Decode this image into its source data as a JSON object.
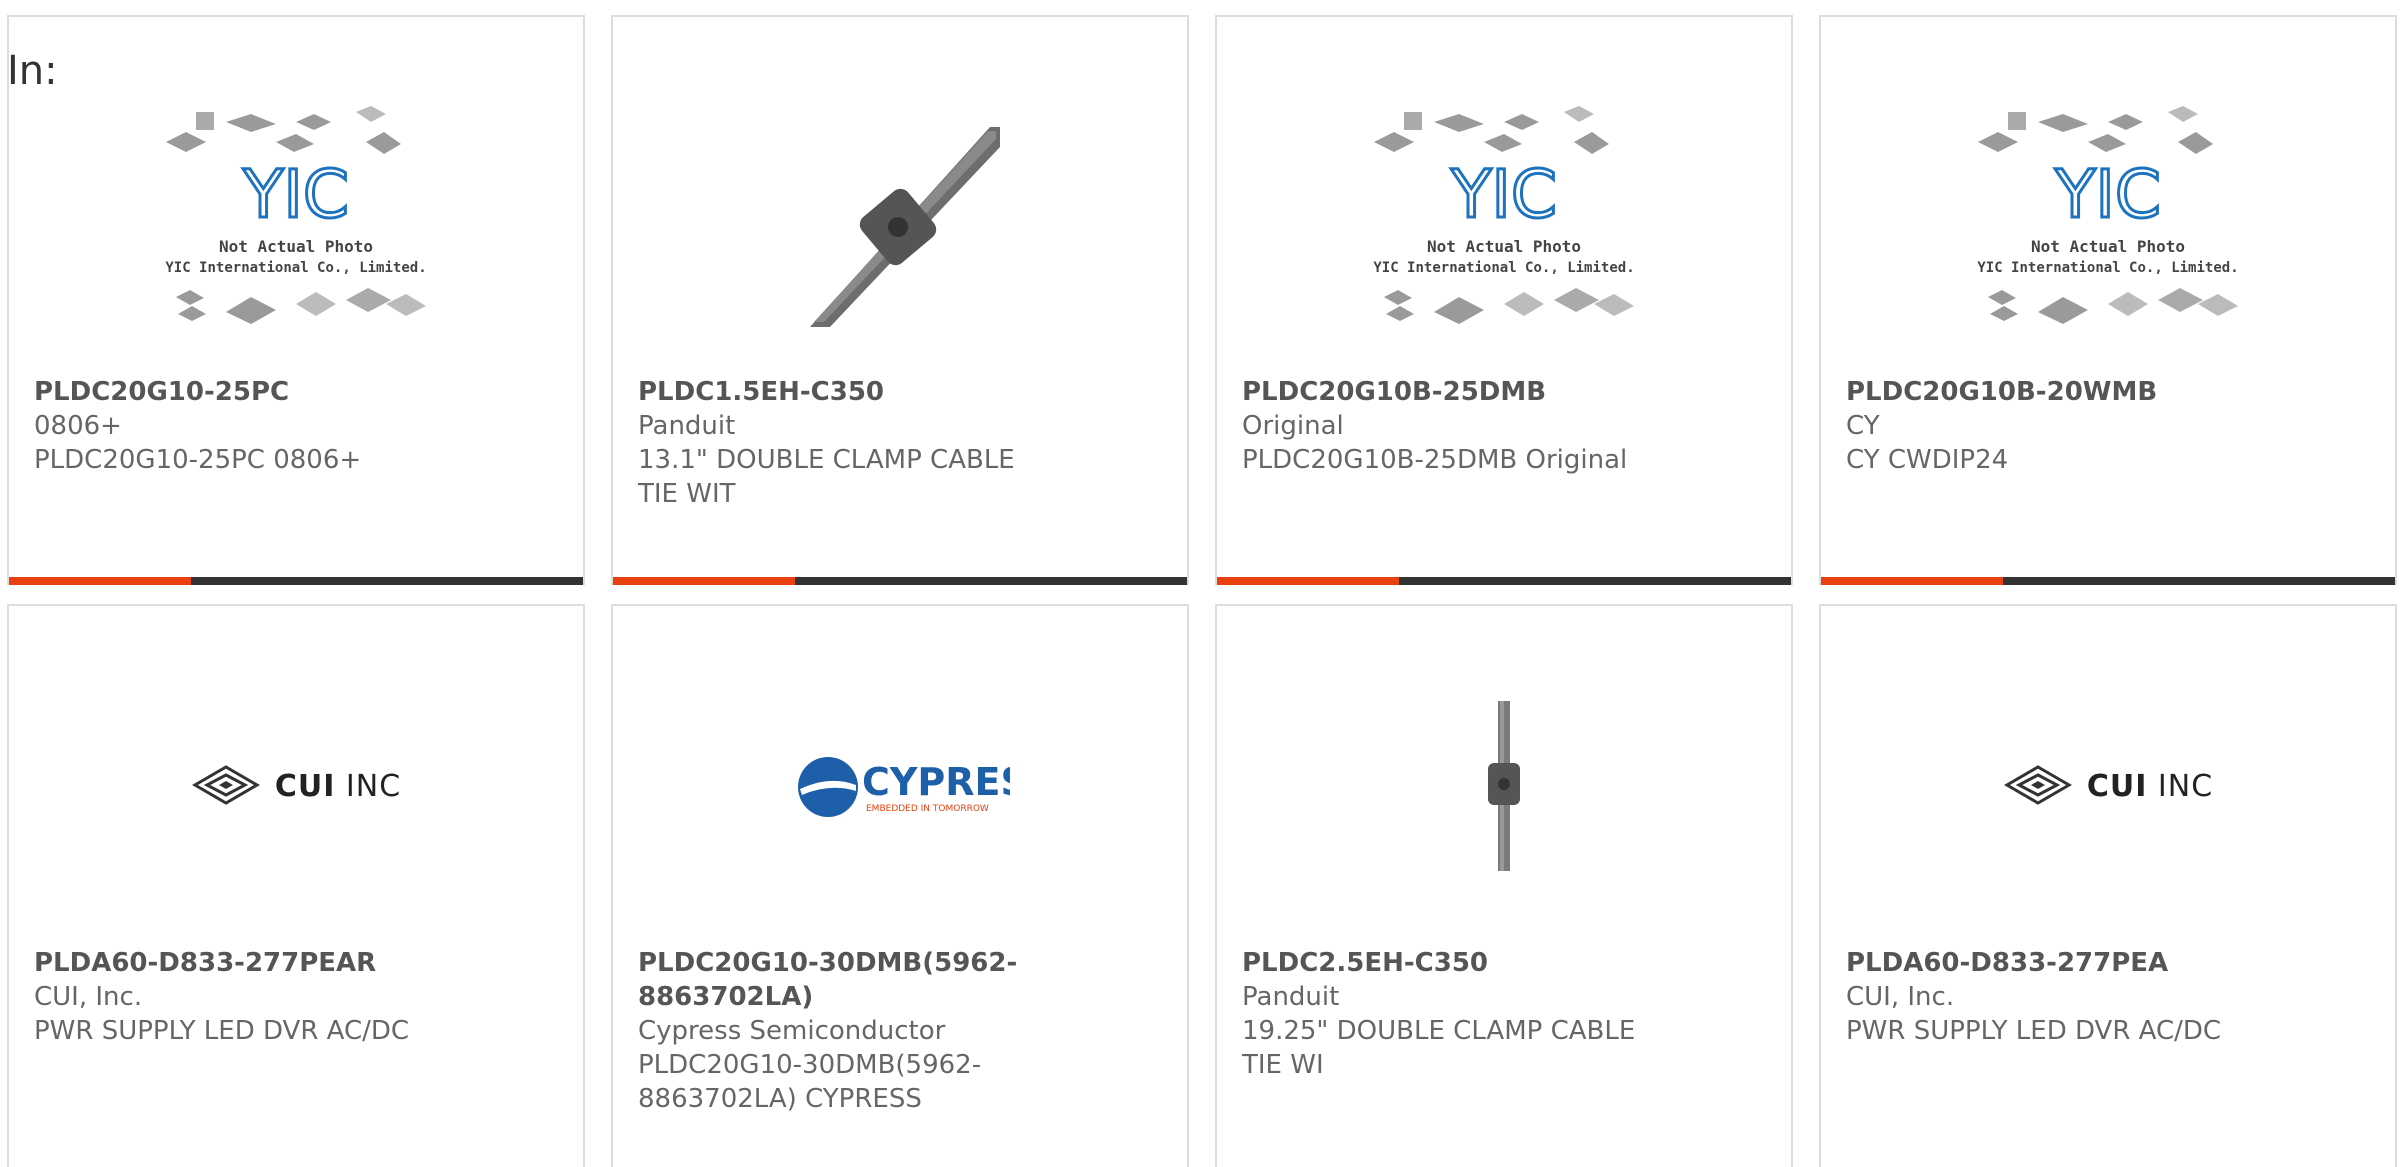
{
  "in_label": "In:",
  "cards": [
    {
      "part": "PLDC20G10-25PC",
      "mfr": "0806+",
      "desc": "PLDC20G10-25PC 0806+",
      "image": "yic-placeholder",
      "placeholder_line1": "Not Actual Photo",
      "placeholder_line2": "YIC International Co., Limited."
    },
    {
      "part": "PLDC1.5EH-C350",
      "mfr": "Panduit",
      "desc": "13.1\" DOUBLE CLAMP CABLE TIE WIT",
      "image": "cable-tie"
    },
    {
      "part": "PLDC20G10B-25DMB",
      "mfr": "Original",
      "desc": "PLDC20G10B-25DMB Original",
      "image": "yic-placeholder",
      "placeholder_line1": "Not Actual Photo",
      "placeholder_line2": "YIC International Co., Limited."
    },
    {
      "part": "PLDC20G10B-20WMB",
      "mfr": "CY",
      "desc": "CY CWDIP24",
      "image": "yic-placeholder",
      "placeholder_line1": "Not Actual Photo",
      "placeholder_line2": "YIC International Co., Limited."
    },
    {
      "part": "PLDA60-D833-277PEAR",
      "mfr": "CUI, Inc.",
      "desc": "PWR SUPPLY LED DVR AC/DC",
      "image": "cui-logo",
      "logo_text_bold": "CUI",
      "logo_text": "INC"
    },
    {
      "part": "PLDC20G10-30DMB(5962-8863702LA)",
      "mfr": "Cypress Semiconductor",
      "desc": "PLDC20G10-30DMB(5962-8863702LA) CYPRESS",
      "image": "cypress-logo",
      "logo_text": "CYPRESS",
      "logo_tagline": "EMBEDDED IN TOMORROW"
    },
    {
      "part": "PLDC2.5EH-C350",
      "mfr": "Panduit",
      "desc": "19.25\" DOUBLE CLAMP CABLE TIE WI",
      "image": "cable-tie-vertical"
    },
    {
      "part": "PLDA60-D833-277PEA",
      "mfr": "CUI, Inc.",
      "desc": "PWR SUPPLY LED DVR AC/DC",
      "image": "cui-logo",
      "logo_text_bold": "CUI",
      "logo_text": "INC"
    }
  ],
  "colors": {
    "accent": "#e8410f",
    "bar": "#333333",
    "border": "#dddddd",
    "text": "#666666",
    "yic_blue": "#1e73be",
    "cypress_blue": "#1d5fa8",
    "cypress_red": "#e8410f"
  }
}
